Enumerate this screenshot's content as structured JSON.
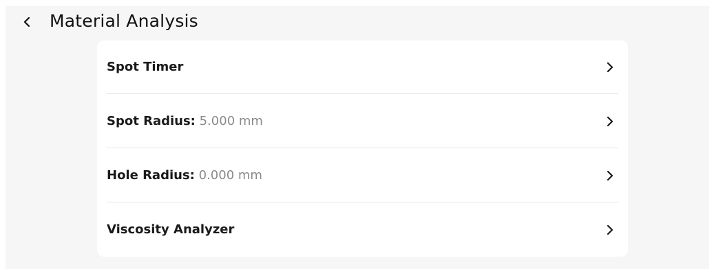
{
  "header": {
    "title": "Material Analysis",
    "back_icon": "chevron-left-icon"
  },
  "settings": {
    "items": [
      {
        "label": "Spot Timer",
        "value": ""
      },
      {
        "label": "Spot Radius:",
        "value": "5.000 mm"
      },
      {
        "label": "Hole Radius:",
        "value": "0.000 mm"
      },
      {
        "label": "Viscosity Analyzer",
        "value": ""
      }
    ],
    "row_icon": "chevron-right-icon"
  },
  "colors": {
    "background": "#f6f6f6",
    "card": "#ffffff",
    "text": "#1a1a1a",
    "value_text": "#8a8a8a",
    "divider": "#e6e6e6"
  }
}
